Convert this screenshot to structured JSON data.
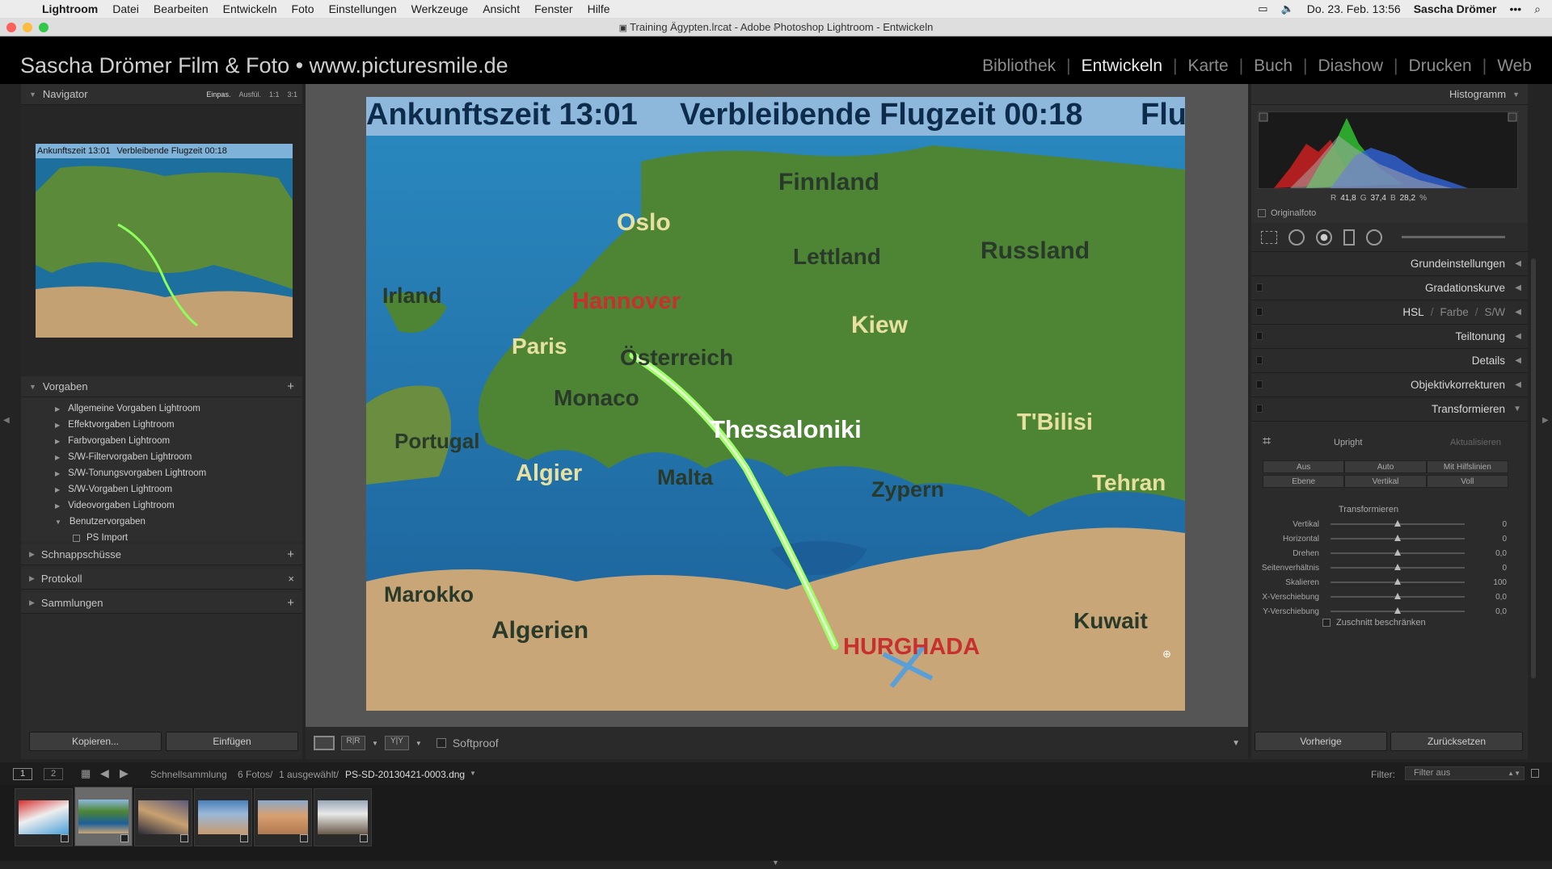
{
  "menubar": {
    "app": "Lightroom",
    "items": [
      "Datei",
      "Bearbeiten",
      "Entwickeln",
      "Foto",
      "Einstellungen",
      "Werkzeuge",
      "Ansicht",
      "Fenster",
      "Hilfe"
    ],
    "clock": "Do. 23. Feb. 13:56",
    "user": "Sascha Drömer"
  },
  "window": {
    "title": "Training Ägypten.lrcat - Adobe Photoshop Lightroom - Entwickeln"
  },
  "identity_plate": "Sascha Drömer Film & Foto • www.picturesmile.de",
  "modules": [
    "Bibliothek",
    "Entwickeln",
    "Karte",
    "Buch",
    "Diashow",
    "Drucken",
    "Web"
  ],
  "active_module": "Entwickeln",
  "navigator": {
    "title": "Navigator",
    "zoom_options": [
      "Einpas.",
      "Ausfül.",
      "1:1",
      "3:1"
    ]
  },
  "photo": {
    "line1_left": "Ankunftszeit 13:01",
    "line1_right": "Verbleibende Flugzeit 00:18",
    "line1_cut": "Flu",
    "places": [
      "Finnland",
      "Oslo",
      "Russland",
      "Lettland",
      "Irland",
      "Hannover",
      "Paris",
      "Österreich",
      "Kiew",
      "Monaco",
      "Thessaloniki",
      "T'Bilisi",
      "Portugal",
      "Algier",
      "Malta",
      "Zypern",
      "Tehran",
      "Marokko",
      "Algerien",
      "HURGHADA",
      "Kuwait"
    ]
  },
  "presets": {
    "title": "Vorgaben",
    "items": [
      "Allgemeine Vorgaben Lightroom",
      "Effektvorgaben Lightroom",
      "Farbvorgaben Lightroom",
      "S/W-Filtervorgaben Lightroom",
      "S/W-Tonungsvorgaben Lightroom",
      "S/W-Vorgaben Lightroom",
      "Videovorgaben Lightroom",
      "Benutzervorgaben"
    ],
    "sub_item": "PS Import"
  },
  "left_sections": [
    "Schnappschüsse",
    "Protokoll",
    "Sammlungen"
  ],
  "left_buttons": {
    "copy": "Kopieren...",
    "paste": "Einfügen"
  },
  "toolbar": {
    "softproof": "Softproof"
  },
  "histogram": {
    "title": "Histogramm",
    "r_label": "R",
    "r": "41,8",
    "g_label": "G",
    "g": "37,4",
    "b_label": "B",
    "b": "28,2",
    "unit": "%",
    "original": "Originalfoto"
  },
  "right_sections": [
    "Grundeinstellungen",
    "Gradationskurve",
    "Teiltonung",
    "Details",
    "Objektivkorrekturen",
    "Transformieren"
  ],
  "hsl": {
    "hsl": "HSL",
    "farbe": "Farbe",
    "sw": "S/W",
    "sep": "/"
  },
  "transform": {
    "upright": "Upright",
    "update": "Aktualisieren",
    "buttons_row1": [
      "Aus",
      "Auto",
      "Mit Hilfslinien"
    ],
    "buttons_row2": [
      "Ebene",
      "Vertikal",
      "Voll"
    ],
    "subheading": "Transformieren",
    "sliders": [
      {
        "label": "Vertikal",
        "value": "0",
        "pos": 0.5
      },
      {
        "label": "Horizontal",
        "value": "0",
        "pos": 0.5
      },
      {
        "label": "Drehen",
        "value": "0,0",
        "pos": 0.5
      },
      {
        "label": "Seitenverhältnis",
        "value": "0",
        "pos": 0.5
      },
      {
        "label": "Skalieren",
        "value": "100",
        "pos": 0.5
      },
      {
        "label": "X-Verschiebung",
        "value": "0,0",
        "pos": 0.5
      },
      {
        "label": "Y-Verschiebung",
        "value": "0,0",
        "pos": 0.5
      }
    ],
    "constrain": "Zuschnitt beschränken"
  },
  "right_buttons": {
    "previous": "Vorherige",
    "reset": "Zurücksetzen"
  },
  "filmstrip_bar": {
    "screen1": "1",
    "screen2": "2",
    "source": "Schnellsammlung",
    "count": "6 Fotos/",
    "selected": "1 ausgewählt/",
    "filename": "PS-SD-20130421-0003.dng",
    "filter_label": "Filter:",
    "filter_value": "Filter aus"
  },
  "colors": {
    "accent_active": "#ececec",
    "panel": "#2b2b2b",
    "menubar": "#ececec"
  }
}
